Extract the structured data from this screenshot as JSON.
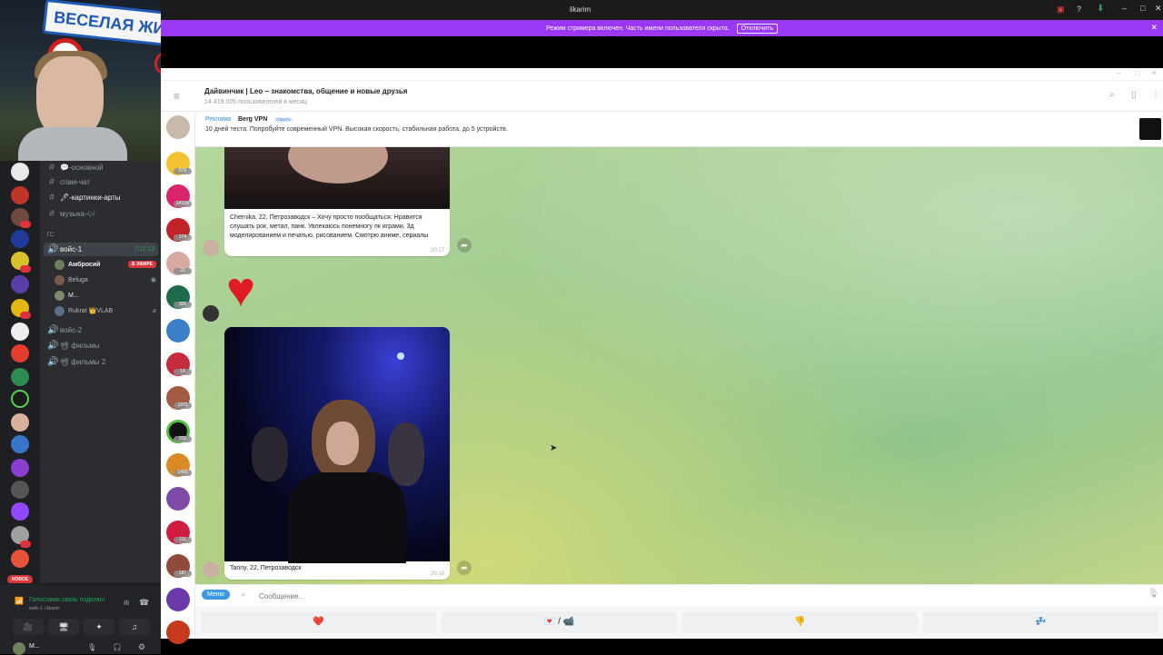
{
  "webcam": {
    "sign_text": "ВЕСЕЛАЯ ЖИЗ"
  },
  "discord": {
    "channels": [
      {
        "icon": "#",
        "label": "💬-основной"
      },
      {
        "icon": "#",
        "label": "спам-чат"
      },
      {
        "icon": "#",
        "label": "🖊-картинки-арты"
      },
      {
        "icon": "#",
        "label": "музыка-🎶"
      }
    ],
    "category": "ГС",
    "voice1": {
      "label": "войс-1",
      "timer": "7:11:13"
    },
    "voice_users": [
      {
        "name": "Амбросий",
        "badge": "В ЭФИРЕ"
      },
      {
        "name": "Beluga",
        "badge": ""
      },
      {
        "name": "M...",
        "badge": ""
      },
      {
        "name": "Rukrat 👑VLAB",
        "badge": ""
      }
    ],
    "other_voice": [
      "войс-2",
      "📽 фильмы",
      "📽 фильмы 2"
    ],
    "new_badge": "НОВОЕ",
    "voice_status": "Голосовая связь подключ",
    "voice_sub": "войс-1 / likarim",
    "me": "M..."
  },
  "telegram": {
    "window_title": "likarim",
    "streamer_notice": "Режим стримера включен. Часть имени пользователя скрыта.",
    "streamer_button": "Отключить",
    "chat_title": "Дайвинчик | Leo – знакомства, общение и новые друзья",
    "chat_subtitle": "14 419 026 пользователей в месяц",
    "ad": {
      "tag": "Реклама",
      "name": "Berg VPN",
      "hide": "скрыть",
      "text": "10 дней теста. Попробуйте современный VPN. Высокая скорость, стабильная работа, до 5 устройств."
    },
    "messages": [
      {
        "caption": "Chernika, 22, Петрозаводск – Хочу просто пообщаться. Нравится слушать рок, метал, панк. Увлекаюсь понемногу пк играми, 3д моделированием и печатью, рисованием. Смотрю аниме, сериалы",
        "time": "20:17"
      },
      {
        "emoji": "❤️"
      },
      {
        "caption": "Tanny, 22, Петрозаводск",
        "time": "20:18"
      }
    ],
    "menu_button": "Меню",
    "input_placeholder": "Сообщение...",
    "keyboard": [
      "❤️",
      "💌 / 📹",
      "👎",
      "💤"
    ],
    "dialog_counts": [
      "573",
      "14104",
      "174",
      "22",
      "305",
      "",
      "18",
      "1972",
      "205",
      "1490",
      "",
      "111",
      "187"
    ]
  }
}
